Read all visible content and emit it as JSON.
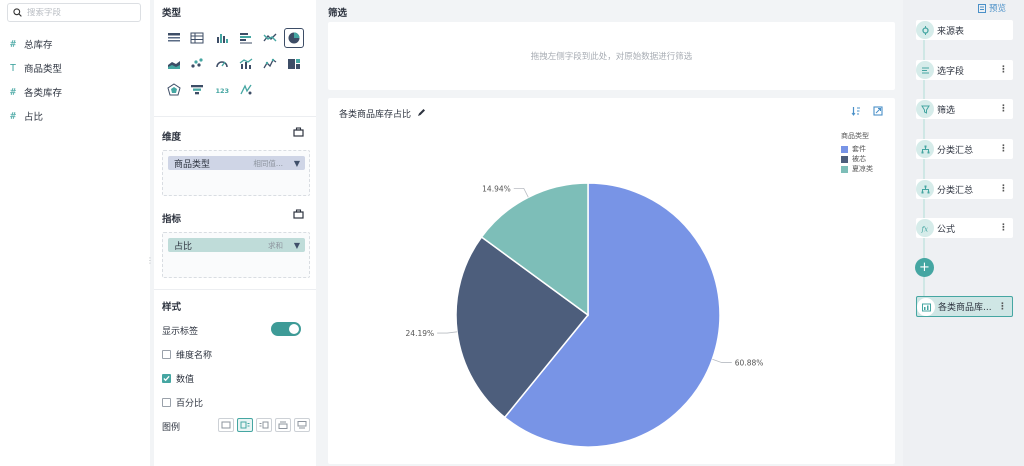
{
  "fields_panel": {
    "search_placeholder": "搜索字段",
    "fields": [
      {
        "type_glyph": "#",
        "label": "总库存"
      },
      {
        "type_glyph": "T",
        "label": "商品类型"
      },
      {
        "type_glyph": "#",
        "label": "各类库存"
      },
      {
        "type_glyph": "#",
        "label": "占比"
      }
    ]
  },
  "config_panel": {
    "type_title": "类型",
    "dimension_title": "维度",
    "dimension_pill": {
      "label": "商品类型",
      "agg": "相同值..."
    },
    "metric_title": "指标",
    "metric_pill": {
      "label": "占比",
      "agg": "求和"
    },
    "style_title": "样式",
    "show_labels": "显示标签",
    "show_labels_on": true,
    "options": [
      {
        "label": "维度名称",
        "checked": false
      },
      {
        "label": "数值",
        "checked": true
      },
      {
        "label": "百分比",
        "checked": false
      }
    ],
    "legend_label": "图例"
  },
  "filter": {
    "title": "筛选",
    "hint": "拖拽左侧字段到此处，对原始数据进行筛选"
  },
  "chart_card": {
    "title": "各类商品库存占比",
    "legend_title": "商品类型",
    "chart_data": {
      "type": "pie",
      "title": "各类商品库存占比",
      "categories": [
        "套件",
        "被芯",
        "夏凉类"
      ],
      "values": [
        60.88,
        24.19,
        14.94
      ],
      "labels": [
        "60.88%",
        "24.19%",
        "14.94%"
      ],
      "colors": [
        "#7894e6",
        "#4d5e7c",
        "#7dbeb8"
      ],
      "legend_title": "商品类型",
      "legend_position": "top-right"
    }
  },
  "flow_panel": {
    "preview_label": "预览",
    "steps": [
      {
        "label": "来源表",
        "icon": "source-icon",
        "has_more": false
      },
      {
        "label": "选字段",
        "icon": "select-fields-icon",
        "has_more": true
      },
      {
        "label": "筛选",
        "icon": "filter-icon",
        "has_more": true
      },
      {
        "label": "分类汇总",
        "icon": "group-summary-icon",
        "has_more": true
      },
      {
        "label": "分类汇总",
        "icon": "group-summary-icon",
        "has_more": true
      },
      {
        "label": "公式",
        "icon": "formula-icon",
        "has_more": true
      }
    ],
    "add_label": "+",
    "final_step": {
      "label": "各类商品库...",
      "icon": "chart-icon"
    },
    "more_glyph": "⋮"
  },
  "colors": {
    "accent": "#45a6a2",
    "dim_pill": "#cfd5e6",
    "metric_pill": "#bfdcd9"
  }
}
